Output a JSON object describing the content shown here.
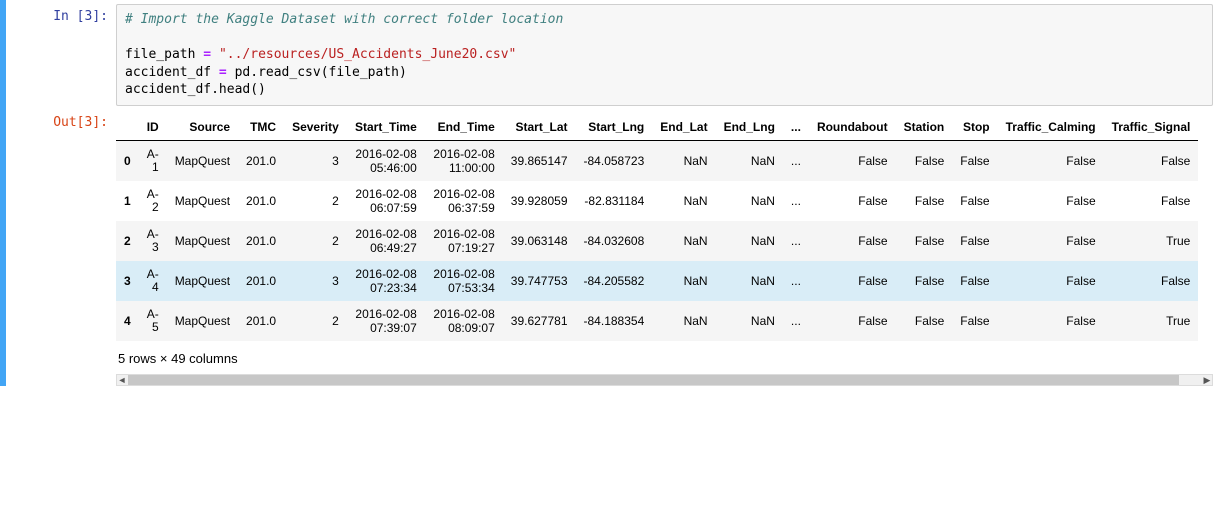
{
  "prompts": {
    "in_label": "In [3]:",
    "out_label": "Out[3]:"
  },
  "code": {
    "comment": "# Import the Kaggle Dataset with correct folder location",
    "l2_var": "file_path",
    "l2_eq": " = ",
    "l2_str": "\"../resources/US_Accidents_June20.csv\"",
    "l3_a": "accident_df",
    "l3_eq": " = ",
    "l3_b": "pd",
    "l3_dot1": ".",
    "l3_c": "read_csv",
    "l3_open": "(",
    "l3_arg": "file_path",
    "l3_close": ")",
    "l4_a": "accident_df",
    "l4_dot": ".",
    "l4_b": "head",
    "l4_par": "()"
  },
  "table": {
    "columns": [
      "ID",
      "Source",
      "TMC",
      "Severity",
      "Start_Time",
      "End_Time",
      "Start_Lat",
      "Start_Lng",
      "End_Lat",
      "End_Lng",
      "...",
      "Roundabout",
      "Station",
      "Stop",
      "Traffic_Calming",
      "Traffic_Signal"
    ],
    "rows": [
      {
        "idx": "0",
        "ID": "A-1",
        "Source": "MapQuest",
        "TMC": "201.0",
        "Severity": "3",
        "Start_Time": "2016-02-08 05:46:00",
        "End_Time": "2016-02-08 11:00:00",
        "Start_Lat": "39.865147",
        "Start_Lng": "-84.058723",
        "End_Lat": "NaN",
        "End_Lng": "NaN",
        "...": "...",
        "Roundabout": "False",
        "Station": "False",
        "Stop": "False",
        "Traffic_Calming": "False",
        "Traffic_Signal": "False"
      },
      {
        "idx": "1",
        "ID": "A-2",
        "Source": "MapQuest",
        "TMC": "201.0",
        "Severity": "2",
        "Start_Time": "2016-02-08 06:07:59",
        "End_Time": "2016-02-08 06:37:59",
        "Start_Lat": "39.928059",
        "Start_Lng": "-82.831184",
        "End_Lat": "NaN",
        "End_Lng": "NaN",
        "...": "...",
        "Roundabout": "False",
        "Station": "False",
        "Stop": "False",
        "Traffic_Calming": "False",
        "Traffic_Signal": "False"
      },
      {
        "idx": "2",
        "ID": "A-3",
        "Source": "MapQuest",
        "TMC": "201.0",
        "Severity": "2",
        "Start_Time": "2016-02-08 06:49:27",
        "End_Time": "2016-02-08 07:19:27",
        "Start_Lat": "39.063148",
        "Start_Lng": "-84.032608",
        "End_Lat": "NaN",
        "End_Lng": "NaN",
        "...": "...",
        "Roundabout": "False",
        "Station": "False",
        "Stop": "False",
        "Traffic_Calming": "False",
        "Traffic_Signal": "True"
      },
      {
        "idx": "3",
        "ID": "A-4",
        "Source": "MapQuest",
        "TMC": "201.0",
        "Severity": "3",
        "Start_Time": "2016-02-08 07:23:34",
        "End_Time": "2016-02-08 07:53:34",
        "Start_Lat": "39.747753",
        "Start_Lng": "-84.205582",
        "End_Lat": "NaN",
        "End_Lng": "NaN",
        "...": "...",
        "Roundabout": "False",
        "Station": "False",
        "Stop": "False",
        "Traffic_Calming": "False",
        "Traffic_Signal": "False"
      },
      {
        "idx": "4",
        "ID": "A-5",
        "Source": "MapQuest",
        "TMC": "201.0",
        "Severity": "2",
        "Start_Time": "2016-02-08 07:39:07",
        "End_Time": "2016-02-08 08:09:07",
        "Start_Lat": "39.627781",
        "Start_Lng": "-84.188354",
        "End_Lat": "NaN",
        "End_Lng": "NaN",
        "...": "...",
        "Roundabout": "False",
        "Station": "False",
        "Stop": "False",
        "Traffic_Calming": "False",
        "Traffic_Signal": "True"
      }
    ],
    "hover_row_index": 3,
    "footer": "5 rows × 49 columns"
  }
}
